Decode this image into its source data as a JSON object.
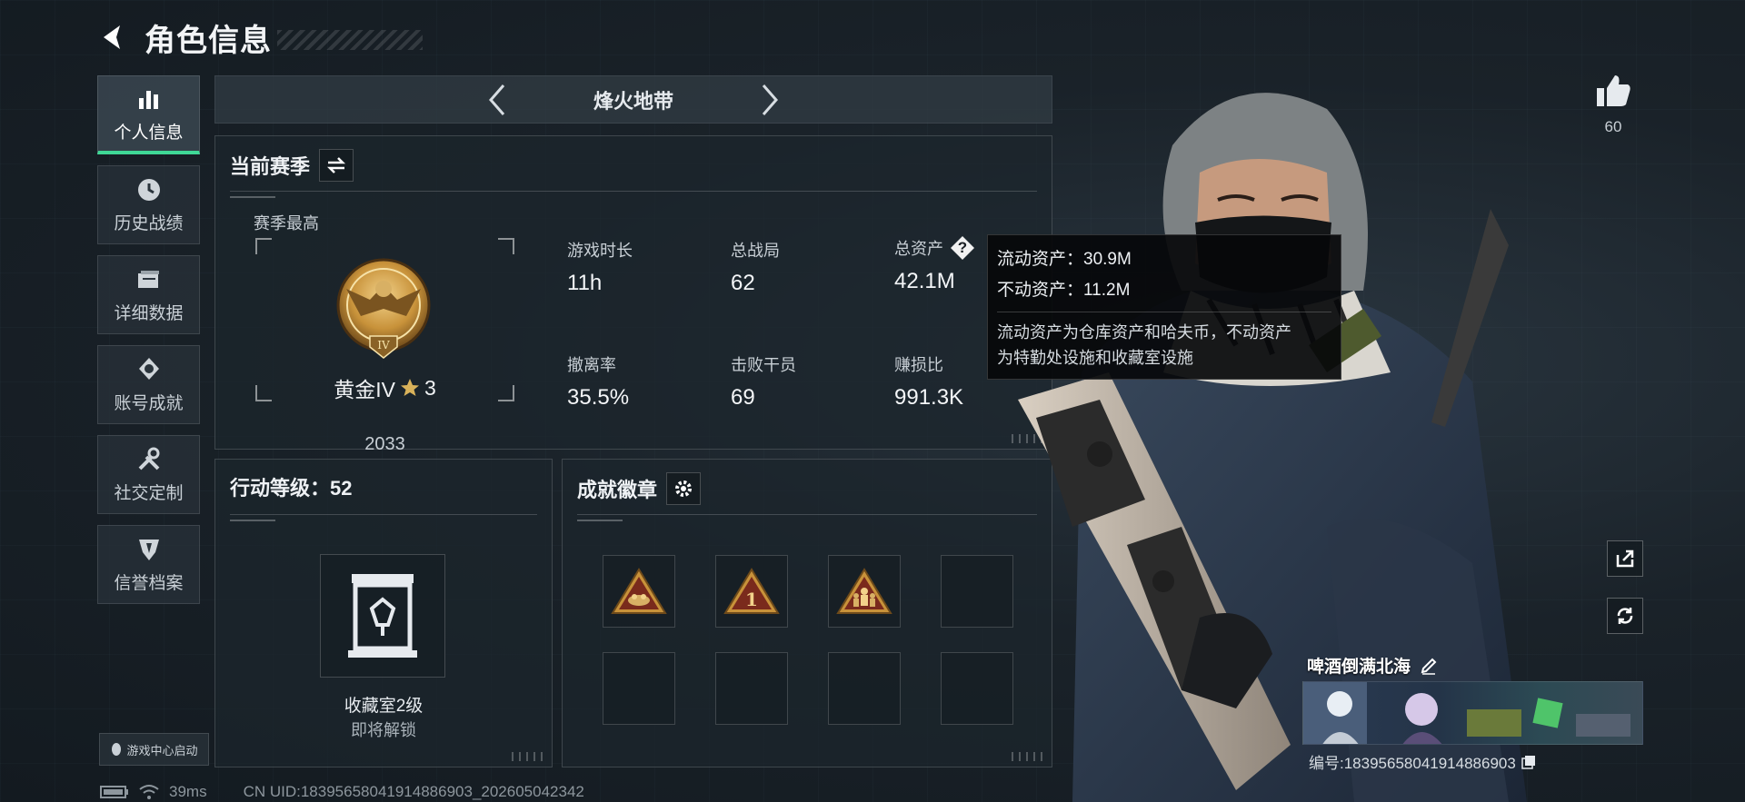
{
  "header": {
    "title": "角色信息"
  },
  "nav": {
    "items": [
      {
        "label": "个人信息",
        "icon": "bar-chart-icon",
        "active": true
      },
      {
        "label": "历史战绩",
        "icon": "clock-icon"
      },
      {
        "label": "详细数据",
        "icon": "folder-icon"
      },
      {
        "label": "账号成就",
        "icon": "medal-icon"
      },
      {
        "label": "社交定制",
        "icon": "wrench-icon"
      },
      {
        "label": "信誉档案",
        "icon": "shield-icon"
      }
    ],
    "launch_label": "游戏中心启动"
  },
  "mode": {
    "title": "烽火地带"
  },
  "season": {
    "title": "当前赛季",
    "best_label": "赛季最高",
    "rank": {
      "name": "黄金IV",
      "stars": "3",
      "score": "2033"
    },
    "stats": [
      {
        "label": "游戏时长",
        "value": "11h"
      },
      {
        "label": "总战局",
        "value": "62"
      },
      {
        "label": "总资产",
        "value": "42.1M"
      },
      {
        "label": "撤离率",
        "value": "35.5%"
      },
      {
        "label": "击败干员",
        "value": "69"
      },
      {
        "label": "赚损比",
        "value": "991.3K"
      }
    ]
  },
  "tooltip": {
    "liquid": "流动资产：30.9M",
    "fixed": "不动资产：11.2M",
    "desc_line1": "流动资产为仓库资产和哈夫币，不动资产",
    "desc_line2": "为特勤处设施和收藏室设施"
  },
  "level": {
    "title": "行动等级：52",
    "vault_name": "收藏室2级",
    "vault_status": "即将解锁"
  },
  "badges": {
    "title": "成就徽章"
  },
  "player": {
    "likes": "60",
    "name": "啤酒倒满北海",
    "id": "编号:18395658041914886903"
  },
  "status": {
    "ping": "39ms",
    "uid": "CN UID:18395658041914886903_202605042342"
  },
  "colors": {
    "accent": "#3fd896",
    "badge_gold": "#c8923a",
    "badge_red": "#7a2a1c"
  }
}
